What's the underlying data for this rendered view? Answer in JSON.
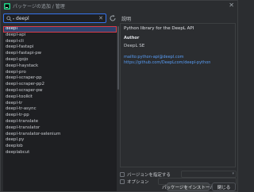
{
  "window": {
    "title": "パッケージの追加 / 管理",
    "close_glyph": "✕"
  },
  "search": {
    "value": "deepl",
    "caret_glyph": "▾",
    "clear_glyph": "✕"
  },
  "packages": [
    "deepl",
    "deepl-api",
    "deepl-cli",
    "deepl-fastapi",
    "deepl-fastapi-pw",
    "deepl-gojo",
    "deepl-haystack",
    "deepl-pro",
    "deepl-scraper-pp",
    "deepl-scraper-pp2",
    "deepl-scraper-pw",
    "deepl-toolkit",
    "deepl-tr",
    "deepl-tr-async",
    "deepl-tr-pp",
    "deepl-translate",
    "deepl-translator",
    "deepl-translator-selenium",
    "deepl.py",
    "deeplob",
    "deeplabcut"
  ],
  "selected_index": 0,
  "description": {
    "label": "説明",
    "summary": "Python library for the DeepL API",
    "author_heading": "Author",
    "author": "DeepL SE",
    "links": [
      "mailto:python-api@deepl.com",
      "https://github.com/DeepLcom/deepl-python"
    ]
  },
  "options": {
    "version_label": "バージョンを指定する",
    "options_label": "オプション"
  },
  "buttons": {
    "install": "パッケージをインストール",
    "close": "閉じる"
  },
  "colors": {
    "accent": "#3574f0",
    "selection": "#2e436e",
    "highlight_border": "#db3b4b",
    "link": "#589df6"
  },
  "icons": {
    "search": "search-icon",
    "refresh": "refresh-icon",
    "app": "pycharm-icon"
  }
}
